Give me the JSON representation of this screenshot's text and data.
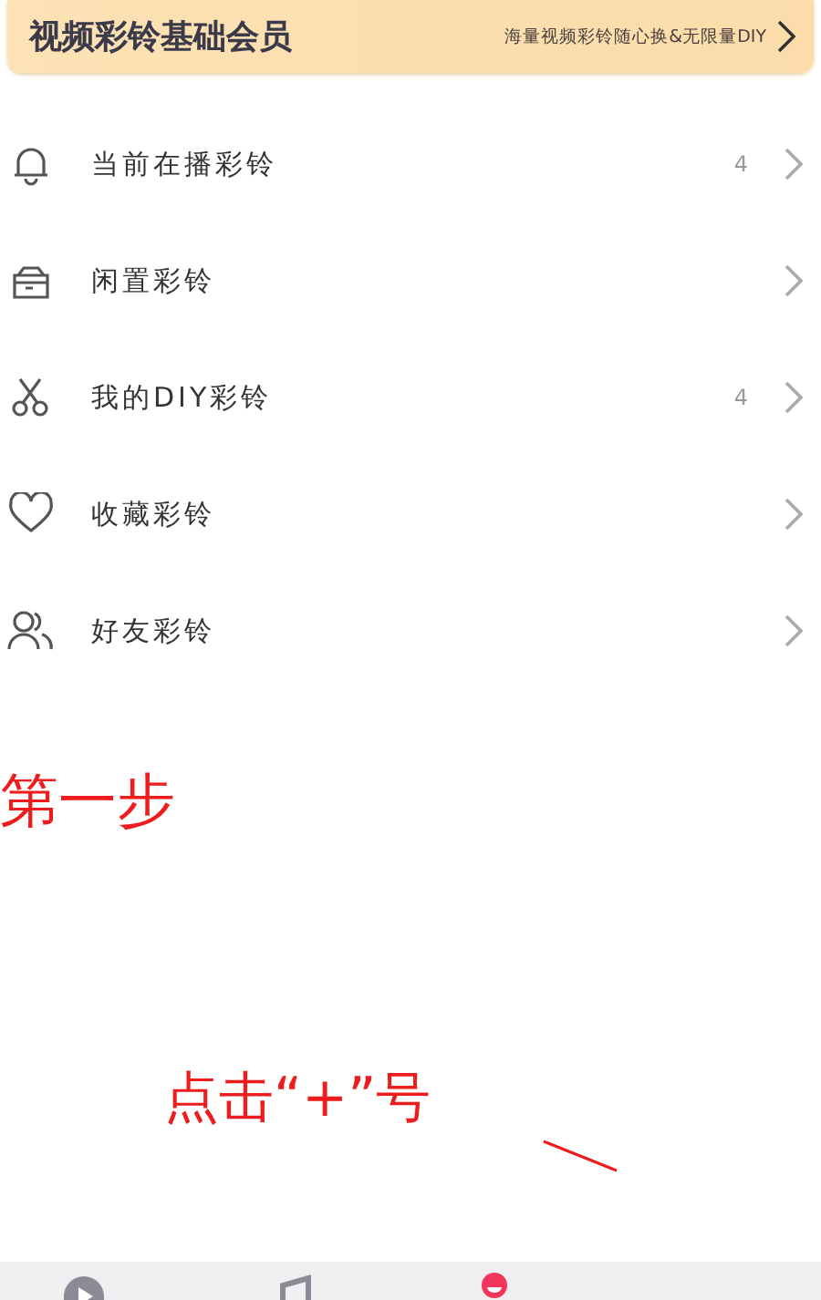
{
  "banner": {
    "title": "视频彩铃基础会员",
    "promo": "海量视频彩铃随心换&无限量DIY"
  },
  "menu": [
    {
      "kind": "bell",
      "label": "当前在播彩铃",
      "count": "4"
    },
    {
      "kind": "box",
      "label": "闲置彩铃"
    },
    {
      "kind": "scissors",
      "label": "我的DIY彩铃",
      "count": "4"
    },
    {
      "kind": "heart",
      "label": "收藏彩铃"
    },
    {
      "kind": "friends",
      "label": "好友彩铃"
    }
  ],
  "annotations": {
    "step": "第一步",
    "hint": "点击“+”号"
  },
  "tab_bar": [
    {
      "kind": "video",
      "selected": false
    },
    {
      "kind": "music",
      "selected": false
    },
    {
      "kind": "person",
      "selected": true
    }
  ]
}
